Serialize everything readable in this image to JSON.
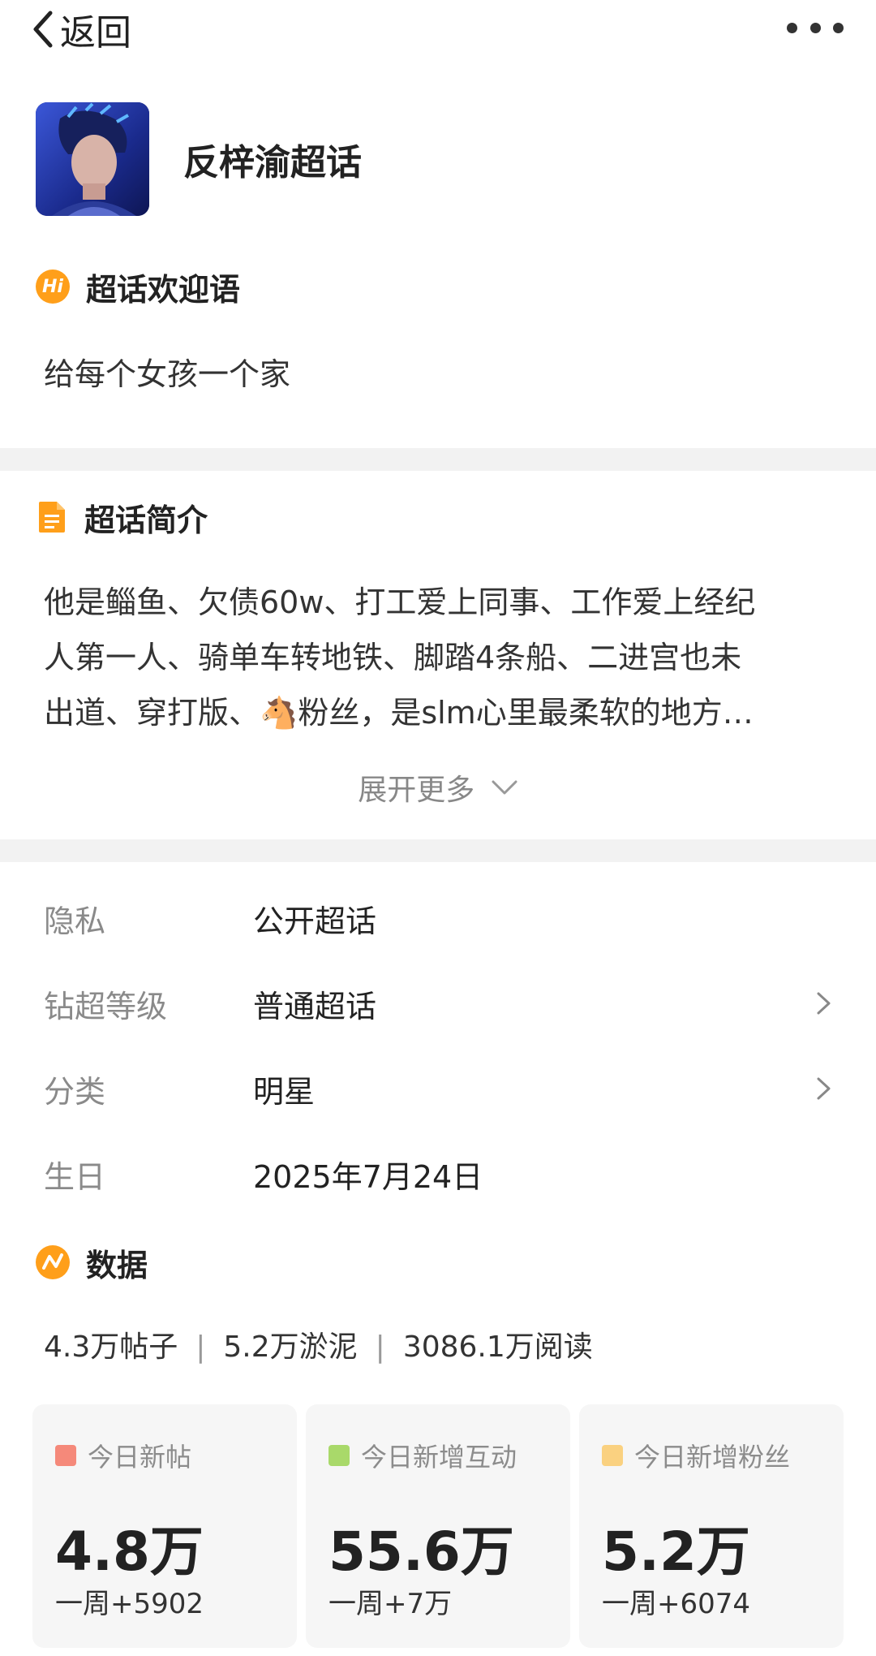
{
  "header": {
    "back_label": "返回"
  },
  "topic": {
    "name": "反梓渝超话"
  },
  "welcome": {
    "title": "超话欢迎语",
    "icon_text": "Hi",
    "text": "给每个女孩一个家"
  },
  "intro": {
    "title": "超话简介",
    "line1": "他是鲻鱼、欠债60w、打工爱上同事、工作爱上经纪",
    "line2": "人第一人、骑单车转地铁、脚踏4条船、二进宫也未",
    "line3": "出道、穿打版、🐴粉丝，是slm心里最柔软的地方…",
    "expand_label": "展开更多"
  },
  "info": [
    {
      "label": "隐私",
      "value": "公开超话"
    },
    {
      "label": "钻超等级",
      "value": "普通超话"
    },
    {
      "label": "分类",
      "value": "明星"
    },
    {
      "label": "生日",
      "value": "2025年7月24日"
    }
  ],
  "data_section": {
    "title": "数据",
    "posts": "4.3万帖子",
    "members": "5.2万淤泥",
    "reads": "3086.1万阅读"
  },
  "cards": [
    {
      "label": "今日新帖",
      "value": "4.8万",
      "week": "一周+5902",
      "color": "#f5897a"
    },
    {
      "label": "今日新增互动",
      "value": "55.6万",
      "week": "一周+7万",
      "color": "#a9d96a"
    },
    {
      "label": "今日新增粉丝",
      "value": "5.2万",
      "week": "一周+6074",
      "color": "#fad180"
    }
  ],
  "colors": {
    "accent": "#ff9f1a",
    "divider": "#f2f2f2"
  }
}
